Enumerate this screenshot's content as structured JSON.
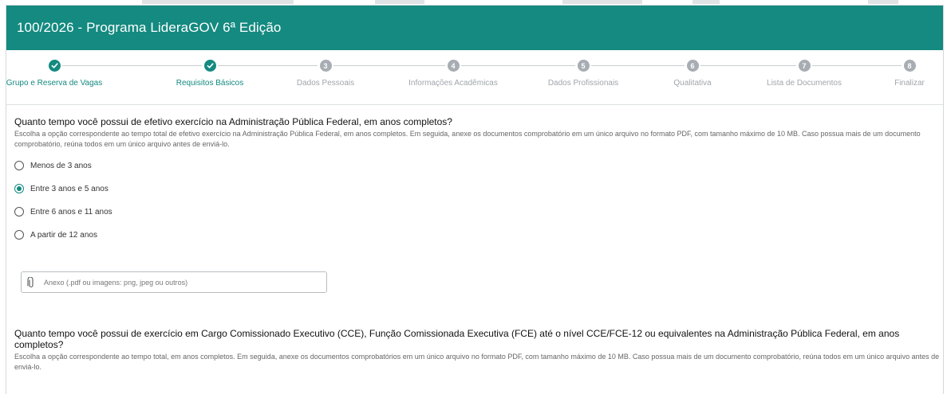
{
  "header": {
    "title": "100/2026 - Programa LideraGOV 6ª Edição"
  },
  "steps": [
    {
      "number": "1",
      "label": "Grupo e Reserva de Vagas",
      "status": "done"
    },
    {
      "number": "2",
      "label": "Requisitos Básicos",
      "status": "done"
    },
    {
      "number": "3",
      "label": "Dados Pessoais",
      "status": "todo"
    },
    {
      "number": "4",
      "label": "Informações Acadêmicas",
      "status": "todo"
    },
    {
      "number": "5",
      "label": "Dados Profissionais",
      "status": "todo"
    },
    {
      "number": "6",
      "label": "Qualitativa",
      "status": "todo"
    },
    {
      "number": "7",
      "label": "Lista de Documentos",
      "status": "todo"
    },
    {
      "number": "8",
      "label": "Finalizar",
      "status": "todo"
    }
  ],
  "question1": {
    "title": "Quanto tempo você possui de efetivo exercício na Administração Pública Federal, em anos completos?",
    "description": "Escolha a opção correspondente ao tempo total de efetivo exercício na Administração Pública Federal, em anos completos. Em seguida, anexe os documentos comprobatório em um único arquivo no formato PDF, com tamanho máximo de 10 MB. Caso possua mais de um documento comprobatório, reúna todos em um único arquivo antes de enviá-lo.",
    "options": [
      {
        "label": "Menos de 3 anos",
        "checked": false
      },
      {
        "label": "Entre 3 anos e 5 anos",
        "checked": true
      },
      {
        "label": "Entre 6 anos e 11 anos",
        "checked": false
      },
      {
        "label": "A partir de 12 anos",
        "checked": false
      }
    ],
    "attachment_placeholder": "Anexo (.pdf ou imagens: png, jpeg ou outros)"
  },
  "question2": {
    "title": "Quanto tempo você possui de exercício em Cargo Comissionado Executivo (CCE), Função Comissionada Executiva (FCE) até o nível CCE/FCE-12 ou equivalentes na Administração Pública Federal, em anos completos?",
    "description": "Escolha a opção correspondente ao tempo total, em anos completos. Em seguida, anexe os documentos comprobatórios em um único arquivo no formato PDF, com tamanho máximo de 10 MB. Caso possua mais de um documento comprobatório, reúna todos em um único arquivo antes de enviá-lo."
  },
  "colors": {
    "primary": "#148a80",
    "step_inactive": "#a7adb2",
    "border": "#d5d9dc"
  },
  "icons": {
    "step_done": "check-icon",
    "attachment": "paperclip-icon"
  }
}
